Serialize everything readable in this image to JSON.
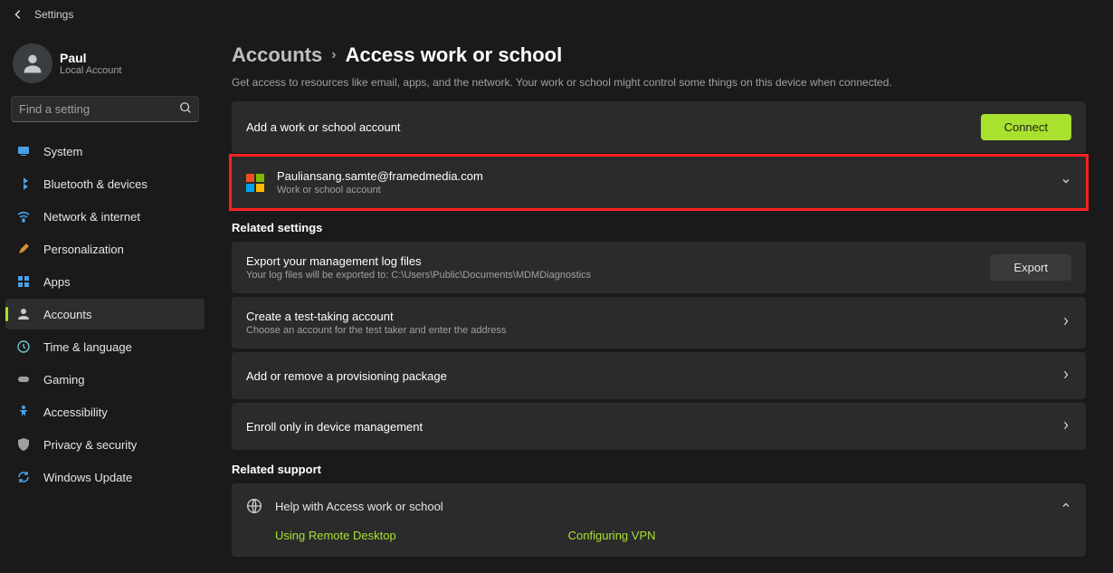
{
  "titlebar": {
    "title": "Settings"
  },
  "user": {
    "name": "Paul",
    "sub": "Local Account"
  },
  "search": {
    "placeholder": "Find a setting"
  },
  "nav": [
    {
      "id": "system",
      "label": "System"
    },
    {
      "id": "bluetooth",
      "label": "Bluetooth & devices"
    },
    {
      "id": "network",
      "label": "Network & internet"
    },
    {
      "id": "personalization",
      "label": "Personalization"
    },
    {
      "id": "apps",
      "label": "Apps"
    },
    {
      "id": "accounts",
      "label": "Accounts"
    },
    {
      "id": "time",
      "label": "Time & language"
    },
    {
      "id": "gaming",
      "label": "Gaming"
    },
    {
      "id": "accessibility",
      "label": "Accessibility"
    },
    {
      "id": "privacy",
      "label": "Privacy & security"
    },
    {
      "id": "update",
      "label": "Windows Update"
    }
  ],
  "active_nav": "accounts",
  "breadcrumb": {
    "parent": "Accounts",
    "current": "Access work or school"
  },
  "description": "Get access to resources like email, apps, and the network. Your work or school might control some things on this device when connected.",
  "add_card": {
    "title": "Add a work or school account",
    "button": "Connect"
  },
  "account_card": {
    "email": "Pauliansang.samte@framedmedia.com",
    "type": "Work or school account"
  },
  "related_title": "Related settings",
  "related": [
    {
      "title": "Export your management log files",
      "sub": "Your log files will be exported to: C:\\Users\\Public\\Documents\\MDMDiagnostics",
      "button": "Export"
    },
    {
      "title": "Create a test-taking account",
      "sub": "Choose an account for the test taker and enter the address"
    },
    {
      "title": "Add or remove a provisioning package"
    },
    {
      "title": "Enroll only in device management"
    }
  ],
  "support_title": "Related support",
  "support": {
    "heading": "Help with Access work or school",
    "links": [
      "Using Remote Desktop",
      "Configuring VPN"
    ]
  }
}
